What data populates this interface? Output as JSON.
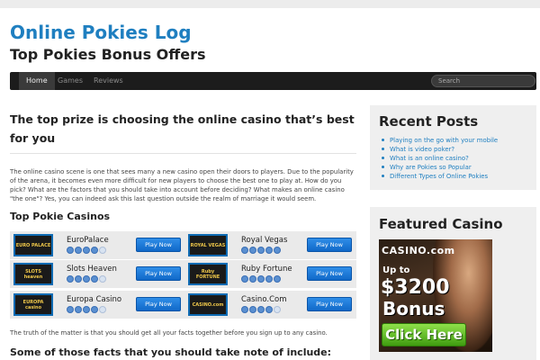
{
  "site": {
    "title": "Online Pokies Log",
    "description": "Top Pokies Bonus Offers"
  },
  "nav": {
    "items": [
      {
        "label": "Home",
        "active": true
      },
      {
        "label": "Games",
        "active": false
      },
      {
        "label": "Reviews",
        "active": false
      }
    ],
    "search_placeholder": "Search"
  },
  "article": {
    "title": "The top prize is choosing the online casino that’s best for you",
    "intro": "The online casino scene is one that sees many a new casino open their doors to players. Due to the popularity of the arena, it becomes even more difficult for new players to choose the best one to play at. How do you pick? What are the factors that you should take into account before deciding? What makes an online casino \"the one\"? Yes, you can indeed ask this last question outside the realm of marriage it would seem.",
    "casinos_heading": "Top Pokie Casinos",
    "casinos": [
      {
        "name": "EuroPalace",
        "logo_text": "EURO PALACE",
        "rating": 4,
        "button": "Play Now"
      },
      {
        "name": "Royal Vegas",
        "logo_text": "ROYAL VEGAS",
        "rating": 5,
        "button": "Play Now"
      },
      {
        "name": "Slots Heaven",
        "logo_text": "SLOTS heaven",
        "rating": 4,
        "button": "Play Now"
      },
      {
        "name": "Ruby Fortune",
        "logo_text": "Ruby FORTUNE",
        "rating": 5,
        "button": "Play Now"
      },
      {
        "name": "Europa Casino",
        "logo_text": "EUROPA casino",
        "rating": 4,
        "button": "Play Now"
      },
      {
        "name": "Casino.Com",
        "logo_text": "CASINO.com",
        "rating": 4,
        "button": "Play Now"
      }
    ],
    "closing": "The truth of the matter is that you should get all your facts together before you sign up to any casino.",
    "facts_heading": "Some of those facts that you should take note of include:"
  },
  "sidebar": {
    "recent_title": "Recent Posts",
    "recent_posts": [
      "Playing on the go with your mobile",
      "What is video poker?",
      "What is an online casino?",
      "Why are Pokies so Popular",
      "Different Types of Online Pokies"
    ],
    "featured_title": "Featured Casino",
    "banner": {
      "logo": "CASINO.com",
      "up_to": "Up to",
      "amount": "$3200",
      "bonus": "Bonus",
      "cta": "Click Here"
    }
  },
  "colors": {
    "accent": "#1f7fc0",
    "navbar": "#1c1c1c",
    "button": "#1068c8"
  }
}
